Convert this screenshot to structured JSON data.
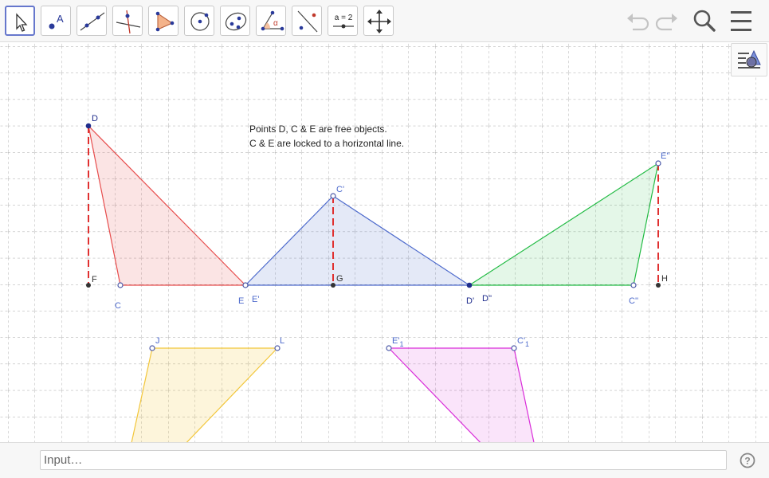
{
  "toolbar": {
    "tools": [
      {
        "name": "move-tool",
        "label": ""
      },
      {
        "name": "point-tool",
        "label": "A"
      },
      {
        "name": "line-tool",
        "label": ""
      },
      {
        "name": "perpendicular-line-tool",
        "label": ""
      },
      {
        "name": "polygon-tool",
        "label": ""
      },
      {
        "name": "circle-center-point-tool",
        "label": ""
      },
      {
        "name": "ellipse-tool",
        "label": ""
      },
      {
        "name": "angle-tool",
        "label": "α"
      },
      {
        "name": "reflect-about-line-tool",
        "label": ""
      },
      {
        "name": "slider-tool",
        "label": "a = 2"
      },
      {
        "name": "move-graphics-view-tool",
        "label": ""
      }
    ],
    "right_buttons": [
      "undo-icon",
      "redo-icon",
      "search-icon",
      "menu-icon"
    ]
  },
  "canvas": {
    "note_line1": "Points D, C & E are free objects.",
    "note_line2": "C & E are locked to a horizontal line.",
    "labels": {
      "D": "D",
      "F": "F",
      "C": "C",
      "E": "E",
      "E1": "E'",
      "G": "G",
      "C1": "C'",
      "D1": "D'",
      "D2": "D''",
      "C2": "C''",
      "E2": "E''",
      "H": "H",
      "J": "J",
      "L": "L",
      "E3": "E'",
      "E3sub": "1",
      "C3": "C'",
      "C3sub": "1"
    },
    "colors": {
      "red": "#e74c4c",
      "blue": "#4d6acc",
      "green": "#22bb44",
      "yellow": "#f2c63a",
      "magenta": "#d92cd9",
      "point_blue": "#4d5aa8"
    }
  },
  "input": {
    "placeholder": "Input…"
  },
  "help": {
    "label": "?"
  }
}
